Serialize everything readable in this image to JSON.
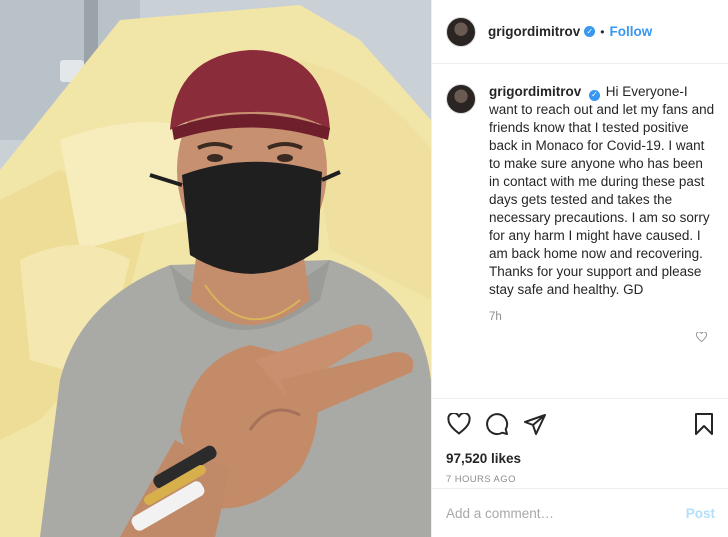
{
  "post": {
    "username": "grigordimitrov",
    "verified_icon": "verified-badge-icon",
    "follow_label": "Follow",
    "separator": "•",
    "caption": "Hi Everyone-I want to reach out and let my fans and friends know that I tested positive back in Monaco for Covid-19. I want to make sure anyone who has been in contact with me during these past days gets tested and takes the necessary precautions. I am so sorry for any harm I might have caused. I am back home now and recovering. Thanks for your support and please stay safe and healthy. GD",
    "caption_age": "7h",
    "likes": "97,520 likes",
    "posted_ago": "7 HOURS AGO"
  },
  "actions": {
    "icons": [
      "heart-icon",
      "comment-icon",
      "share-icon",
      "bookmark-icon"
    ]
  },
  "comment_box": {
    "placeholder": "Add a comment…",
    "post_label": "Post"
  },
  "colors": {
    "accent": "#3897f0",
    "muted": "#8e8e8e",
    "border": "#efefef",
    "post_disabled": "#b2dffc"
  }
}
